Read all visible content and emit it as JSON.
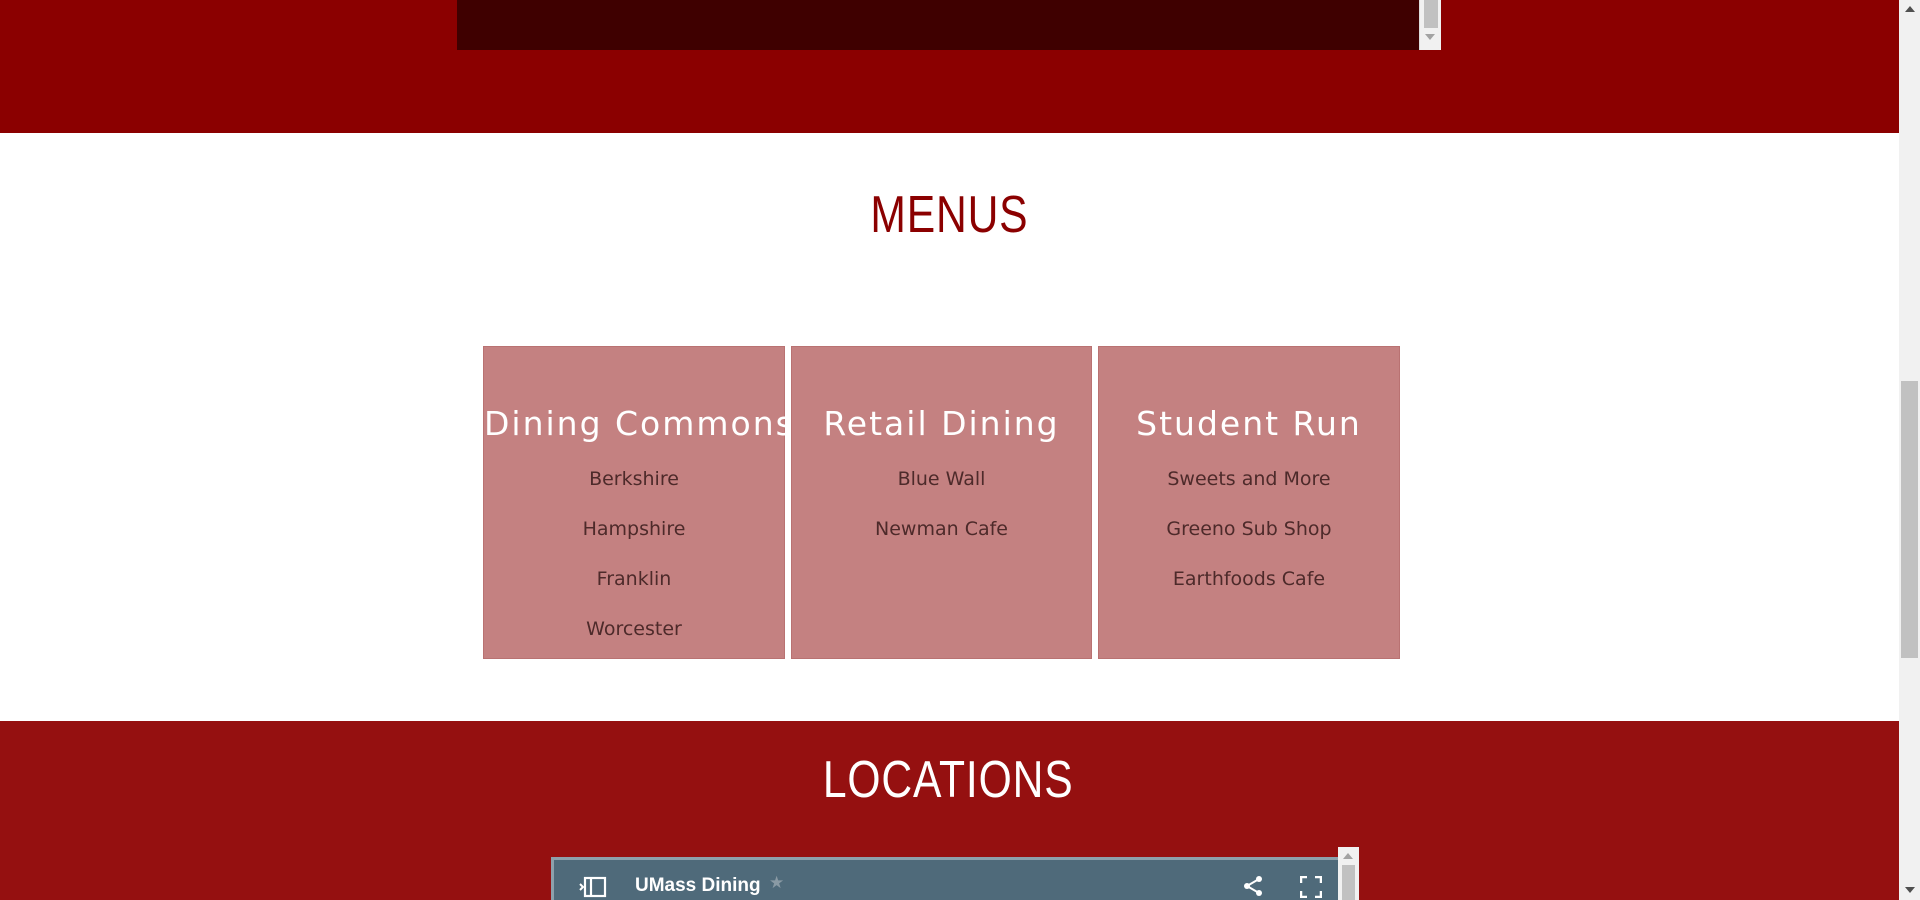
{
  "menus": {
    "title": "MENUS",
    "cards": [
      {
        "title": "Dining Commons",
        "items": [
          "Berkshire",
          "Hampshire",
          "Franklin",
          "Worcester"
        ]
      },
      {
        "title": "Retail Dining",
        "items": [
          "Blue Wall",
          "Newman Cafe"
        ]
      },
      {
        "title": "Student Run",
        "items": [
          "Sweets and More",
          "Greeno Sub Shop",
          "Earthfoods Cafe"
        ]
      }
    ]
  },
  "locations": {
    "title": "LOCATIONS",
    "map": {
      "title": "UMass Dining",
      "star_icon": "star-icon",
      "panel_icon": "side-panel-icon",
      "share_icon": "share-icon",
      "fullscreen_icon": "fullscreen-icon"
    }
  },
  "colors": {
    "top_band": "#8b0000",
    "embed_dark": "#3f0000",
    "menus_title": "#8b0000",
    "card_bg": "#c48181",
    "locations_band": "#951010",
    "map_header": "#4f6a7a"
  }
}
